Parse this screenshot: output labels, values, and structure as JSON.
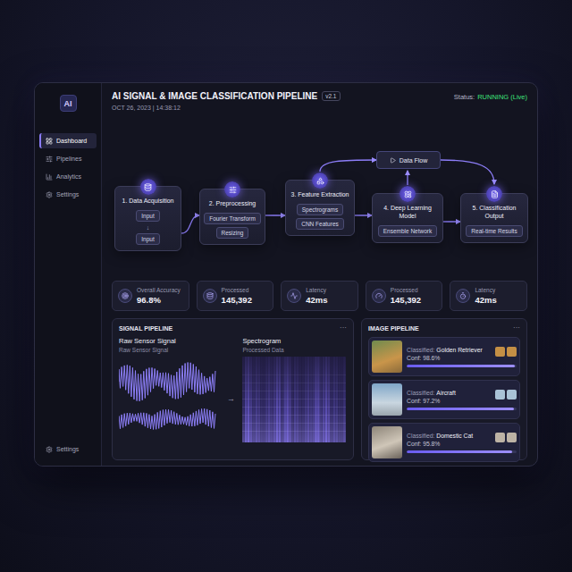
{
  "sidebar": {
    "logo": "AI",
    "items": [
      {
        "label": "Dashboard",
        "selected": true
      },
      {
        "label": "Pipelines",
        "selected": false
      },
      {
        "label": "Analytics",
        "selected": false
      },
      {
        "label": "Settings",
        "selected": false
      }
    ],
    "footer": "Settings"
  },
  "header": {
    "title": "AI SIGNAL & IMAGE CLASSIFICATION PIPELINE",
    "version": "v2.1",
    "timestamp": "OCT 26, 2023 | 14:38:12",
    "status_label": "Status:",
    "status_value": "RUNNING (Live)"
  },
  "pipeline": {
    "nodes": [
      {
        "title": "1. Data Acquisition",
        "chips": [
          "Input",
          "Input"
        ],
        "separator": "↓"
      },
      {
        "title": "2. Preprocessing",
        "chips": [
          "Fourier Transform",
          "Resizing"
        ],
        "separator": ""
      },
      {
        "title": "3. Feature Extraction",
        "chips": [
          "Spectrograms",
          "CNN Features"
        ],
        "separator": ""
      },
      {
        "title": "4. Deep Learning Model",
        "chips": [
          "Ensemble Network"
        ],
        "separator": ""
      },
      {
        "title": "5. Classification Output",
        "chips": [
          "Real-time Results"
        ],
        "separator": ""
      }
    ],
    "data_flow": {
      "label": "Data Flow"
    }
  },
  "stats": [
    {
      "label": "Overall Accuracy",
      "value": "96.8%"
    },
    {
      "label": "Processed",
      "value": "145,392"
    },
    {
      "label": "Latency",
      "value": "42ms"
    },
    {
      "label": "Processed",
      "value": "145,392"
    },
    {
      "label": "Latency",
      "value": "42ms"
    }
  ],
  "signal_pipeline": {
    "title": "SIGNAL PIPELINE",
    "menu": "···",
    "raw": {
      "title": "Raw Sensor Signal",
      "subtitle": "Raw Sensor Signal"
    },
    "arrow": "→",
    "spectrogram": {
      "title": "Spectrogram",
      "subtitle": "Processed Data"
    }
  },
  "image_pipeline": {
    "title": "IMAGE PIPELINE",
    "menu": "···",
    "results": [
      {
        "prefix": "Classified:",
        "name": "Golden Retriever",
        "confidence": "Conf: 98.6%",
        "level": 0.986
      },
      {
        "prefix": "Classified:",
        "name": "Aircraft",
        "confidence": "Conf: 97.2%",
        "level": 0.972
      },
      {
        "prefix": "Classified:",
        "name": "Domestic Cat",
        "confidence": "Conf: 95.8%",
        "level": 0.958
      }
    ]
  }
}
